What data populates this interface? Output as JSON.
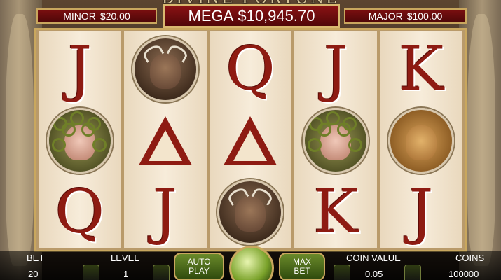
{
  "header": {
    "title": "DIVINE FORTUNE"
  },
  "jackpots": {
    "minor_label": "MINOR",
    "minor_value": "$20.00",
    "mega_label": "MEGA",
    "mega_value": "$10,945.70",
    "major_label": "MAJOR",
    "major_value": "$100.00"
  },
  "reels": [
    [
      "J",
      "medusa",
      "Q"
    ],
    [
      "bull",
      "delta",
      "J"
    ],
    [
      "Q",
      "delta",
      "bull"
    ],
    [
      "J",
      "medusa",
      "K"
    ],
    [
      "K",
      "lion",
      "J"
    ]
  ],
  "controls": {
    "bet_label": "BET",
    "bet_value": "20",
    "level_label": "LEVEL",
    "level_value": "1",
    "autoplay_line1": "AUTO",
    "autoplay_line2": "PLAY",
    "maxbet_line1": "MAX",
    "maxbet_line2": "BET",
    "coin_value_label": "COIN VALUE",
    "coin_value": "0.05",
    "coins_label": "COINS",
    "coins_value": "100000"
  },
  "colors": {
    "accent_red": "#8e1b12",
    "gold_border": "#c9a75e",
    "button_green": "#6a8a2a"
  }
}
